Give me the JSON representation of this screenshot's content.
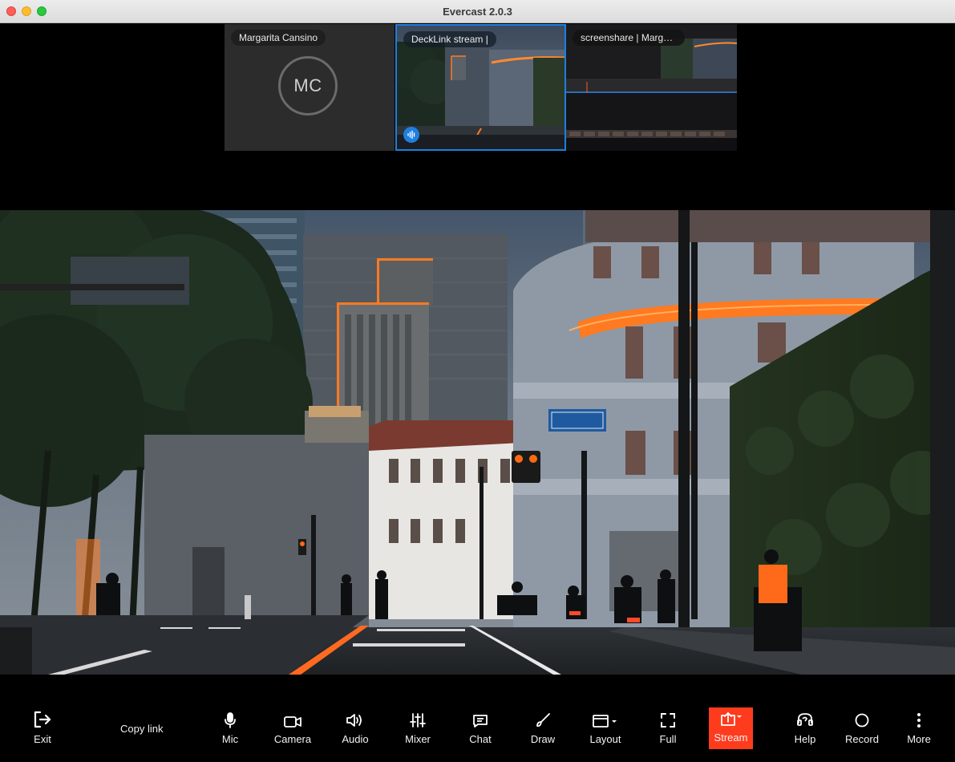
{
  "window": {
    "title": "Evercast 2.0.3"
  },
  "tiles": [
    {
      "label": "Margarita Cansino",
      "initials": "MC"
    },
    {
      "label": "DeckLink stream |"
    },
    {
      "label": "screenshare | Margarita..."
    }
  ],
  "toolbar": {
    "exit": "Exit",
    "copy_link": "Copy link",
    "mic": "Mic",
    "camera": "Camera",
    "audio": "Audio",
    "mixer": "Mixer",
    "chat": "Chat",
    "draw": "Draw",
    "layout": "Layout",
    "full": "Full",
    "stream": "Stream",
    "help": "Help",
    "record": "Record",
    "more": "More"
  },
  "colors": {
    "accent": "#1e7fe0",
    "stream_active": "#ff3b1e",
    "street_glow": "#ff7a20"
  },
  "icons": [
    "exit-icon",
    "mic-icon",
    "camera-icon",
    "audio-icon",
    "mixer-icon",
    "chat-icon",
    "draw-icon",
    "layout-icon",
    "fullscreen-icon",
    "stream-icon",
    "help-icon",
    "record-icon",
    "more-icon",
    "speaking-icon"
  ]
}
